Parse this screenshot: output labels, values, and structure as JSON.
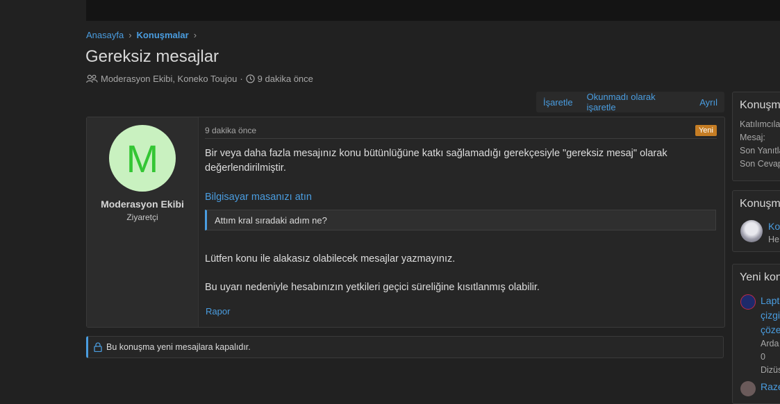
{
  "breadcrumb": {
    "home": "Anasayfa",
    "section": "Konuşmalar"
  },
  "page_title": "Gereksiz mesajlar",
  "meta": {
    "participants": "Moderasyon Ekibi, Koneko Toujou",
    "separator": "·",
    "time": "9 dakika önce"
  },
  "actions": {
    "mark": "İşaretle",
    "mark_unread": "Okunmadı olarak işaretle",
    "leave": "Ayrıl"
  },
  "message": {
    "avatar_letter": "M",
    "username": "Moderasyon Ekibi",
    "user_title": "Ziyaretçi",
    "time": "9 dakika önce",
    "badge": "Yeni",
    "paragraph1": "Bir veya daha fazla mesajınız konu bütünlüğüne katkı sağlamadığı gerekçesiyle \"gereksiz mesaj\" olarak değerlendirilmiştir.",
    "link": "Bilgisayar masanızı atın",
    "quote": "Attım kral sıradaki adım ne?",
    "paragraph2": "Lütfen konu ile alakasız olabilecek mesajlar yazmayınız.",
    "paragraph3": "Bu uyarı nedeniyle hesabınızın yetkileri geçici süreliğine kısıtlanmış olabilir.",
    "report": "Rapor"
  },
  "closed_notice": "Bu konuşma yeni mesajlara kapalıdır.",
  "sidebar": {
    "block1": {
      "title": "Konuşma",
      "lines": [
        "Katılımcıla",
        "Mesaj:",
        "Son Yanıtla",
        "Son Cevap"
      ]
    },
    "block2": {
      "title": "Konuşma",
      "link": "Ko",
      "sub": "He"
    },
    "block3": {
      "title": "Yeni kon",
      "item1_lines": [
        "Lapt",
        "çizgi",
        "çöze"
      ],
      "item1_sub": [
        "Arda",
        "0",
        "Dizüs"
      ],
      "item2": "Raze"
    }
  },
  "colors": {
    "accent": "#4a9de0",
    "badge": "#c57d24",
    "avatar_bg": "#c9f1c0",
    "avatar_fg": "#34c634"
  }
}
